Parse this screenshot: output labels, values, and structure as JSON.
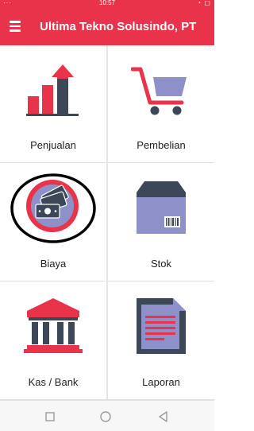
{
  "status_bar": {
    "time": "10:57",
    "left_icons": "···",
    "right_icons": "◔ ▢"
  },
  "app_bar": {
    "title": "Ultima Tekno Solusindo, PT",
    "menu_icon": "hamburger-menu-icon"
  },
  "tiles": [
    {
      "label": "Penjualan",
      "icon": "sales-chart-icon"
    },
    {
      "label": "Pembelian",
      "icon": "shopping-cart-icon"
    },
    {
      "label": "Biaya",
      "icon": "money-icon"
    },
    {
      "label": "Stok",
      "icon": "stock-box-icon"
    },
    {
      "label": "Kas / Bank",
      "icon": "bank-icon"
    },
    {
      "label": "Laporan",
      "icon": "report-document-icon"
    }
  ],
  "nav_bar": {
    "icons": [
      "recent-apps-icon",
      "home-icon",
      "back-icon"
    ]
  },
  "colors": {
    "primary": "#e8334a",
    "dark_slate": "#3c4858",
    "lavender": "#8e91c9",
    "annotation_circle": "#000000"
  }
}
